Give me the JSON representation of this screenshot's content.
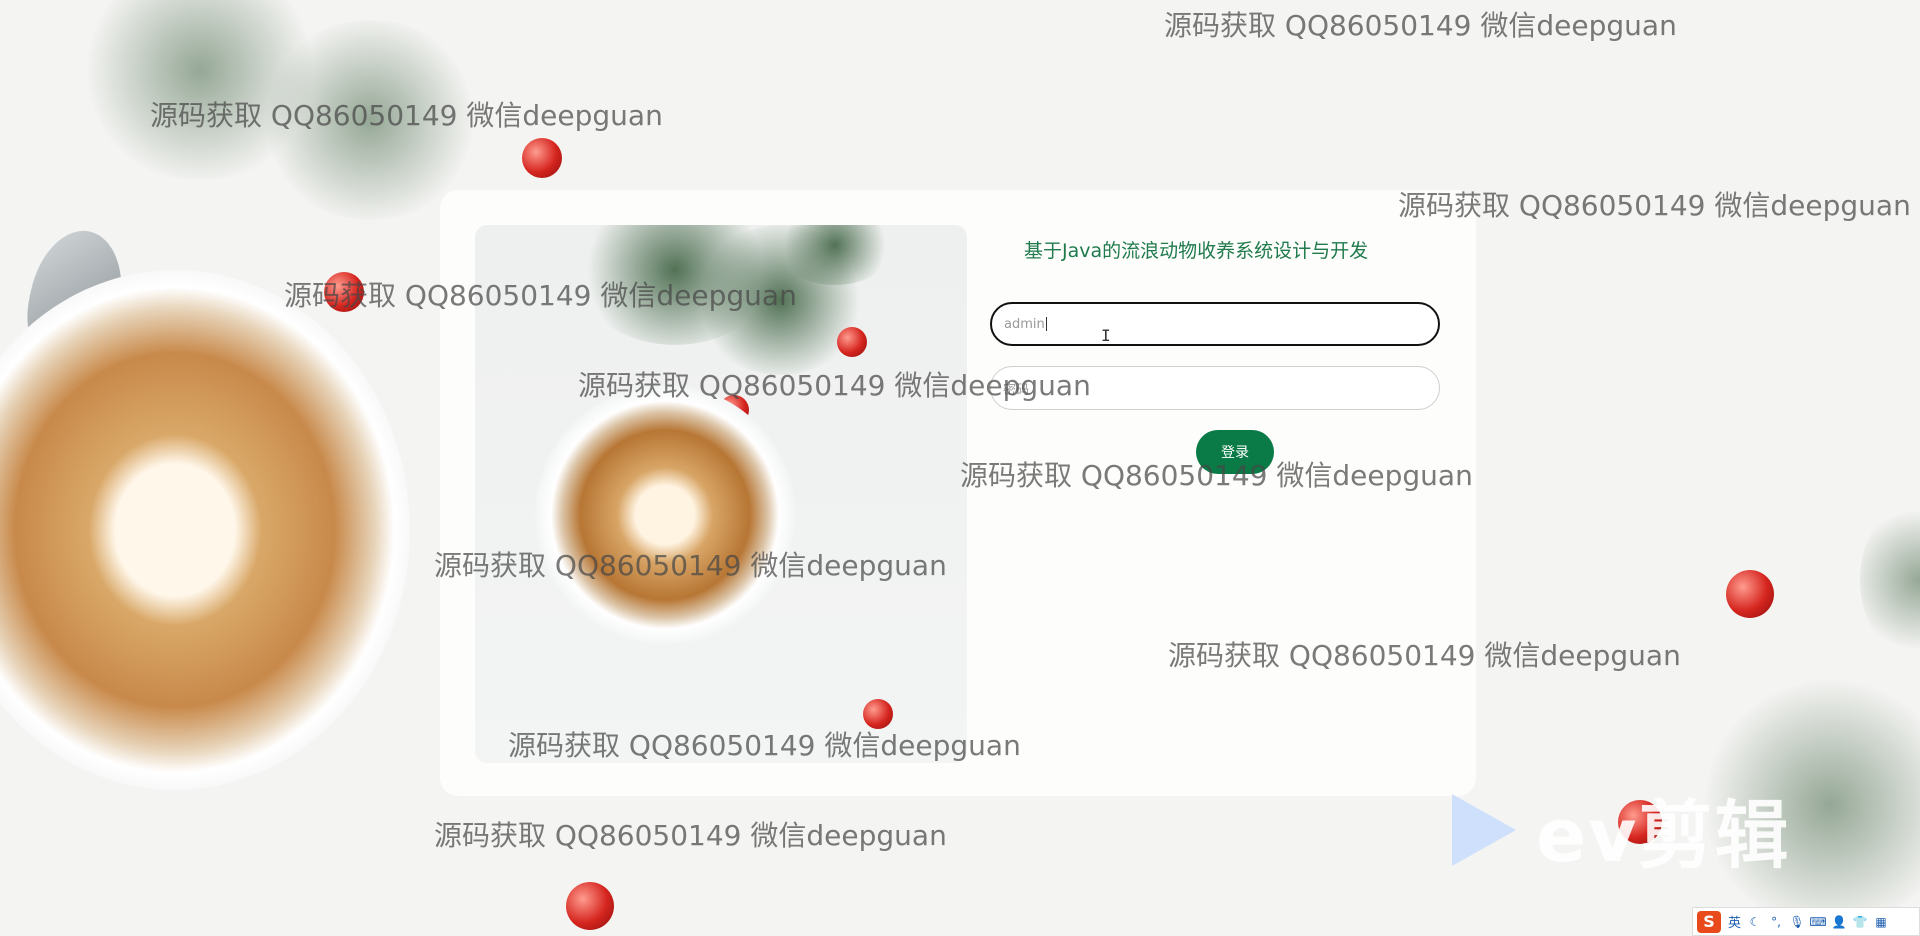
{
  "login": {
    "title": "基于Java的流浪动物收养系统设计与开发",
    "username_value": "admin",
    "password_placeholder": "密码",
    "login_button": "登录"
  },
  "watermark": {
    "text": "源码获取 QQ86050149 微信deepguan"
  },
  "ev_logo": {
    "text": "ev剪辑"
  },
  "ime": {
    "logo": "S",
    "mode": "英",
    "icons": [
      "moon-icon",
      "punctuation-icon",
      "microphone-icon",
      "keyboard-icon",
      "user-icon",
      "shirt-icon",
      "grid-icon"
    ]
  },
  "colors": {
    "accent": "#0a7a46",
    "title": "#1f7a4c"
  }
}
